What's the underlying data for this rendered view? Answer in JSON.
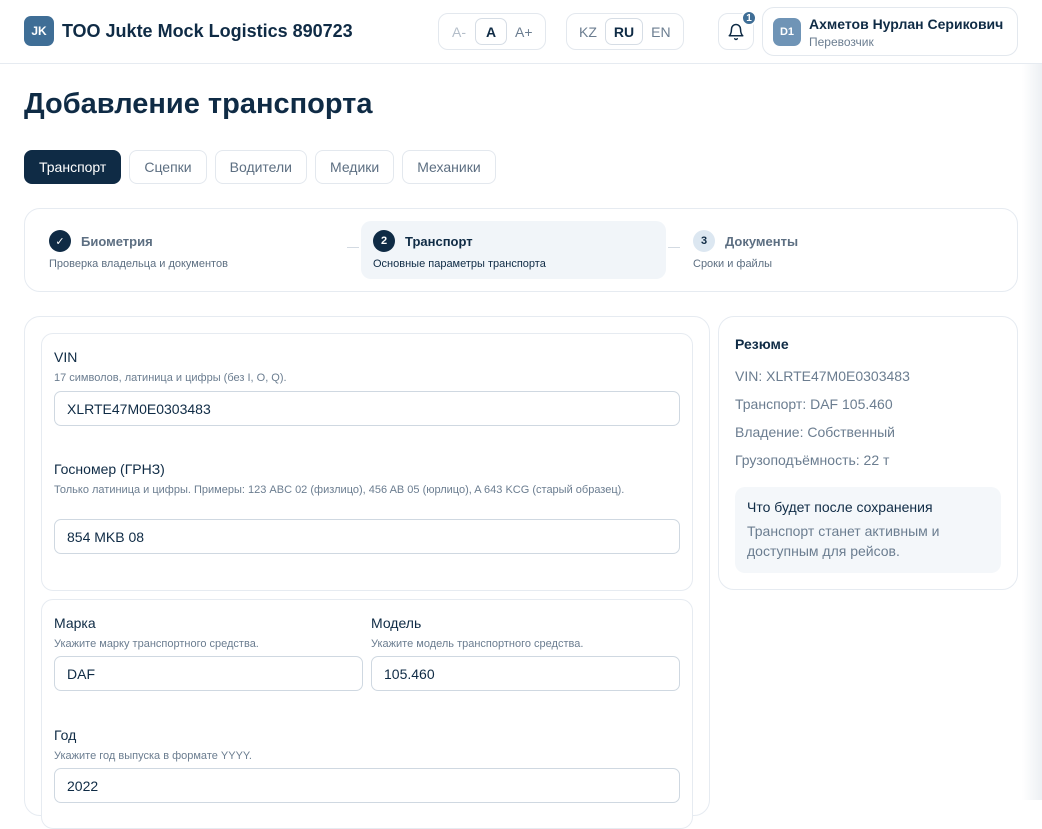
{
  "header": {
    "logo_text": "JK",
    "company": "ТОО Jukte Mock Logistics 890723",
    "font_size": [
      "A-",
      "A",
      "A+"
    ],
    "languages": [
      "KZ",
      "RU",
      "EN"
    ],
    "notification_count": "1",
    "user": {
      "avatar": "D1",
      "name": "Ахметов Нурлан Серикович",
      "role": "Перевозчик"
    }
  },
  "page_title": "Добавление транспорта",
  "tabs": [
    "Транспорт",
    "Сцепки",
    "Водители",
    "Медики",
    "Механики"
  ],
  "steps": [
    {
      "number": "✓",
      "title": "Биометрия",
      "subtitle": "Проверка владельца и документов"
    },
    {
      "number": "2",
      "title": "Транспорт",
      "subtitle": "Основные параметры транспорта"
    },
    {
      "number": "3",
      "title": "Документы",
      "subtitle": "Сроки и файлы"
    }
  ],
  "form": {
    "vin": {
      "label": "VIN",
      "hint": "17 символов, латиница и цифры (без I, O, Q).",
      "value": "XLRTE47M0E0303483"
    },
    "plate": {
      "label": "Госномер (ГРНЗ)",
      "hint": "Только латиница и цифры. Примеры: 123 ABC 02 (физлицо), 456 AB 05 (юрлицо), A 643 KCG (старый образец).",
      "value": "854 MKB 08"
    },
    "brand": {
      "label": "Марка",
      "hint": "Укажите марку транспортного средства.",
      "value": "DAF"
    },
    "model": {
      "label": "Модель",
      "hint": "Укажите модель транспортного средства.",
      "value": "105.460"
    },
    "year": {
      "label": "Год",
      "hint": "Укажите год выпуска в формате YYYY.",
      "value": "2022"
    }
  },
  "summary": {
    "title": "Резюме",
    "rows": [
      "VIN: XLRTE47M0E0303483",
      "Транспорт: DAF 105.460",
      "Владение: Собственный",
      "Грузоподъёмность: 22 т"
    ],
    "after_title": "Что будет после сохранения",
    "after_text": "Транспорт станет активным и доступным для рейсов."
  }
}
